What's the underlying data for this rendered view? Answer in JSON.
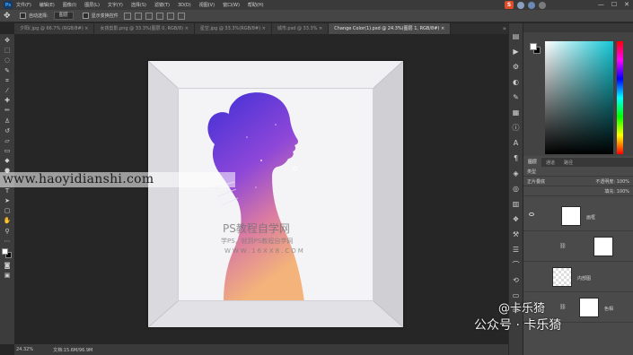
{
  "menubar": {
    "items": [
      "文件(F)",
      "编辑(E)",
      "图像(I)",
      "图层(L)",
      "文字(Y)",
      "选择(S)",
      "滤镜(T)",
      "3D(D)",
      "视图(V)",
      "窗口(W)",
      "帮助(H)"
    ],
    "window_controls": [
      "—",
      "☐",
      "✕"
    ]
  },
  "options": {
    "auto_select_label": "自动选择:",
    "auto_select_value": "图层",
    "show_transform_label": "显示变换控件"
  },
  "tabs": [
    {
      "label": "夕阳(.jpg @ 66.7% (RGB/8#) ×",
      "active": false
    },
    {
      "label": "女孩剪影.png @ 33.3%(图层 0, RGB/8) ×",
      "active": false
    },
    {
      "label": "星空.jpg @ 33.3%(RGB/8#) ×",
      "active": false
    },
    {
      "label": "城市.psd @ 33.3% ×",
      "active": false
    },
    {
      "label": "Change Color(1).psd @ 24.3%(图层 1, RGB/8#) ×",
      "active": true
    }
  ],
  "status": {
    "zoom": "24.32%",
    "doc": "文档:15.6M/96.9M"
  },
  "watermarks": {
    "url": "www.haoyidianshi.com",
    "ps_title": "PS教程自学网",
    "ps_subtitle": "学PS，就到PS教程自学网",
    "ps_url": "WWW.16XX8.COM",
    "author": "@卡乐猗",
    "account": "公众号 · 卡乐猗"
  },
  "layers_panel": {
    "tabs": [
      "图层",
      "通道",
      "路径"
    ],
    "kind_label": "类型",
    "blend_mode": "正片叠底",
    "opacity_label": "不透明度:",
    "opacity_value": "100%",
    "fill_label": "填充:",
    "fill_value": "100%",
    "layers": [
      {
        "name": "画框"
      },
      {
        "name": ""
      },
      {
        "name": "内部图"
      },
      {
        "name": "色相"
      }
    ]
  },
  "colors": {
    "picker_hue": "#12c8d6",
    "foreground": "#ffffff",
    "background": "#000000"
  }
}
